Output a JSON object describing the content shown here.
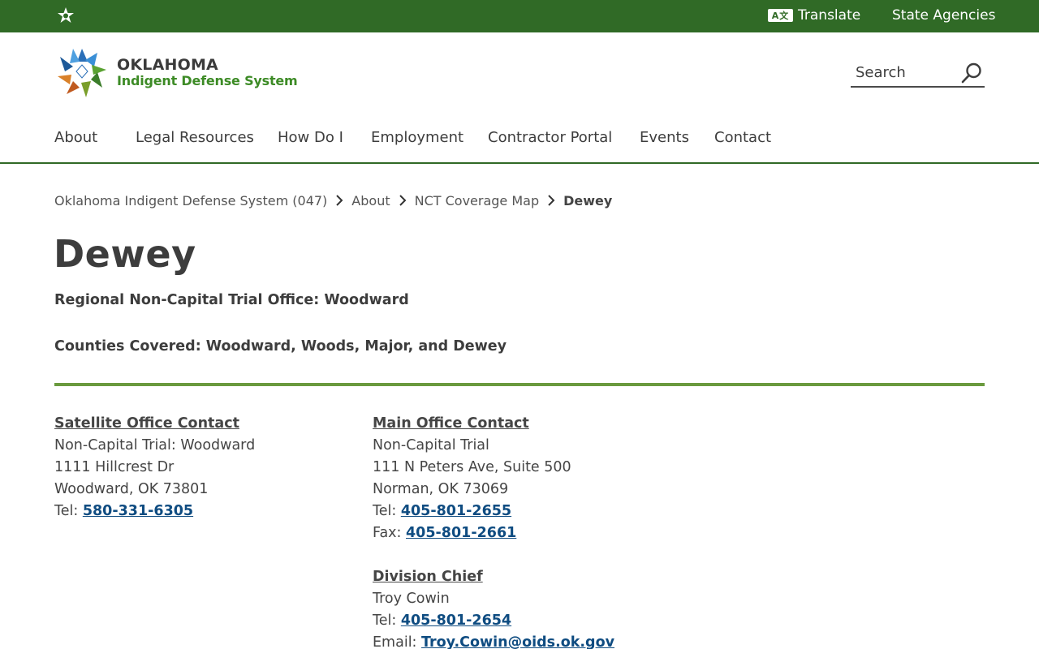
{
  "topbar": {
    "translate_label": "Translate",
    "translate_icon": "translate-icon",
    "state_agencies_label": "State Agencies",
    "state_logo_icon": "oklahoma-star-icon",
    "background_color": "#306a26"
  },
  "brand": {
    "line1": "OKLAHOMA",
    "line2": "Indigent Defense System",
    "accent_color": "#3d8b26"
  },
  "search": {
    "placeholder": "Search",
    "icon": "search-icon"
  },
  "nav": {
    "items": [
      {
        "label": "About"
      },
      {
        "label": "Legal Resources"
      },
      {
        "label": "How Do I"
      },
      {
        "label": "Employment"
      },
      {
        "label": "Contractor Portal"
      },
      {
        "label": "Events"
      },
      {
        "label": "Contact"
      }
    ]
  },
  "breadcrumb": {
    "items": [
      {
        "label": "Oklahoma Indigent Defense System (047)"
      },
      {
        "label": "About"
      },
      {
        "label": "NCT Coverage Map"
      }
    ],
    "current": "Dewey",
    "separator_icon": "chevron-right-icon"
  },
  "page": {
    "title": "Dewey",
    "regional_office": "Regional Non-Capital Trial Office: Woodward",
    "counties_covered": "Counties Covered: Woodward, Woods, Major, and Dewey",
    "rule_color": "#6a9a3e",
    "link_color": "#0f4c81"
  },
  "satellite": {
    "heading": "Satellite Office Contact",
    "name": "Non-Capital Trial: Woodward",
    "address1": "1111 Hillcrest Dr",
    "address2": "Woodward, OK 73801",
    "tel_label": "Tel: ",
    "tel": "580-331-6305"
  },
  "main_office": {
    "heading": "Main Office Contact",
    "name": "Non-Capital Trial",
    "address1": "111 N Peters Ave, Suite 500",
    "address2": "Norman, OK 73069",
    "tel_label": "Tel: ",
    "tel": "405-801-2655",
    "fax_label": "Fax: ",
    "fax": "405-801-2661"
  },
  "division_chief": {
    "heading": "Division Chief",
    "name": "Troy Cowin",
    "tel_label": "Tel: ",
    "tel": "405-801-2654",
    "email_label": "Email: ",
    "email": "Troy.Cowin@oids.ok.gov"
  }
}
